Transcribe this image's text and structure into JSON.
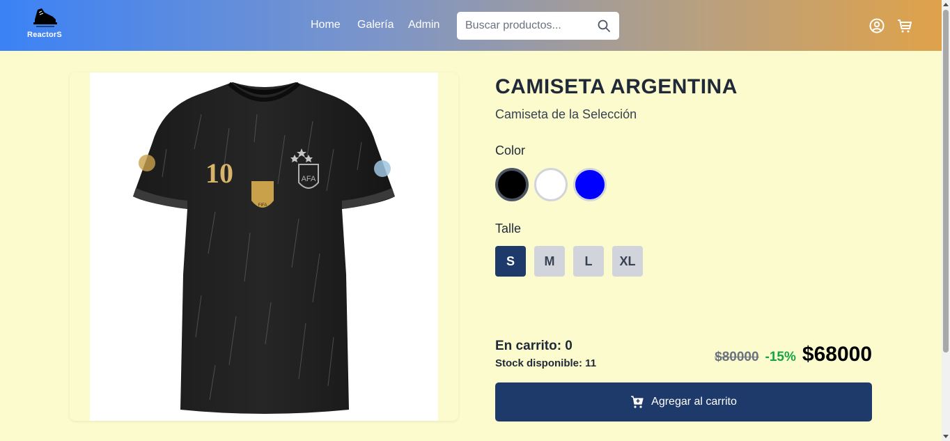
{
  "brand": {
    "name": "ReactorS"
  },
  "nav": {
    "items": [
      "Home",
      "Galería",
      "Admin"
    ]
  },
  "search": {
    "placeholder": "Buscar productos..."
  },
  "product": {
    "title": "CAMISETA ARGENTINA",
    "subtitle": "Camiseta de la Selección",
    "color_label": "Color",
    "colors": [
      {
        "name": "black",
        "hex": "#000000",
        "selected": true
      },
      {
        "name": "white",
        "hex": "#ffffff",
        "selected": false
      },
      {
        "name": "blue",
        "hex": "#0000ff",
        "selected": false
      }
    ],
    "size_label": "Talle",
    "sizes": [
      "S",
      "M",
      "L",
      "XL"
    ],
    "selected_size": "S",
    "in_cart": "En carrito: 0",
    "stock": "Stock disponible: 11",
    "old_price": "$80000",
    "discount": "-15%",
    "price": "$68000",
    "add_button": "Agregar al carrito",
    "jersey_number": "10",
    "crest_text": "AFA",
    "badge_text": "FIFA"
  },
  "colors": {
    "page_bg": "#fbfbcd",
    "primary": "#1e3a6b",
    "discount_green": "#16a34a",
    "size_inactive": "#d1d5db"
  },
  "icons": {
    "logo": "sneaker-icon",
    "search": "search-icon",
    "user": "user-circle-icon",
    "cart": "cart-icon",
    "add_cart": "cart-plus-icon"
  }
}
